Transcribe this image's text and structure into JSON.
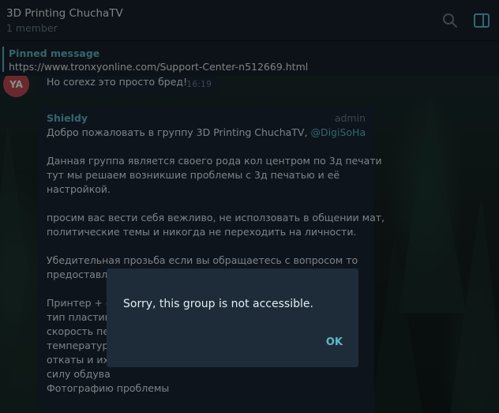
{
  "header": {
    "title": "3D Printing ChuchaTV",
    "subtitle": "1 member",
    "search_icon": "search-icon",
    "panel_icon": "sidebar-panel-icon",
    "accent": "#5fb9c7"
  },
  "pinned": {
    "title": "Pinned message",
    "text": "https://www.tronxyonline.com/Support-Center-n512669.html"
  },
  "messages": [
    {
      "avatar_initials": "YA",
      "avatar_color": "#c24d52",
      "text": "Но corexz это просто бред!",
      "time": "16:19"
    },
    {
      "sender": "Shieldy",
      "role": "admin",
      "lines": [
        "Добро пожаловать в группу 3D Printing ChuchaTV,",
        "@DigiSoHa",
        "Данная группа является своего рода кол центром по 3д печати",
        "тут мы решаем возникшие проблемы с 3д печатью и её",
        "настройкой.",
        "просим вас вести себя вежливо, не исползовать в общении мат,",
        "политические темы и никогда не переходить на личности.",
        "Убедительная прозьба если вы обращаетесь с вопросом то",
        "предоставля",
        "Принтер + е",
        "тип пластик",
        "скорость пе",
        "температур",
        "откаты и их",
        "силу обдува",
        "Фотографию проблемы"
      ]
    }
  ],
  "dialog": {
    "text": "Sorry, this group is not accessible.",
    "ok_label": "OK"
  }
}
